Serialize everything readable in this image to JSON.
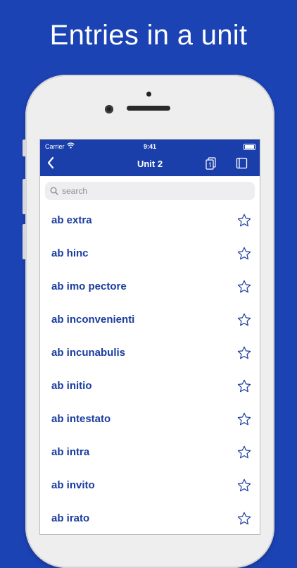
{
  "headline": "Entries in a unit",
  "status_bar": {
    "carrier": "Carrier",
    "time": "9:41"
  },
  "navbar": {
    "title": "Unit 2"
  },
  "search": {
    "placeholder": "search"
  },
  "entries": [
    "ab extra",
    "ab hinc",
    "ab imo pectore",
    "ab inconvenienti",
    "ab incunabulis",
    "ab initio",
    "ab intestato",
    "ab intra",
    "ab invito",
    "ab irato"
  ],
  "colors": {
    "background": "#1b43b4",
    "navbar": "#1b3faa",
    "entry_text": "#1a3c9e",
    "star": "#1a3c9e"
  },
  "icons": {
    "back": "chevron-left-icon",
    "flashcards": "flashcard-icon",
    "book": "book-icon",
    "search": "search-icon",
    "favorite": "star-outline-icon"
  }
}
